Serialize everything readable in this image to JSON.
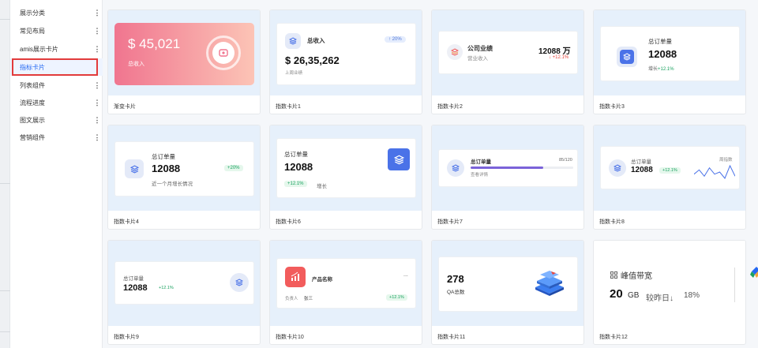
{
  "sidebar": {
    "items": [
      {
        "label": "展示分类"
      },
      {
        "label": "常见布局"
      },
      {
        "label": "amis展示卡片"
      },
      {
        "label": "指标卡片",
        "active": true
      },
      {
        "label": "列表组件"
      },
      {
        "label": "流程进度"
      },
      {
        "label": "图文展示"
      },
      {
        "label": "营销组件"
      }
    ],
    "more_glyph": "⋮"
  },
  "cards": [
    {
      "caption": "渐变卡片",
      "value": "$ 45,021",
      "label": "总收入"
    },
    {
      "caption": "指数卡片1",
      "title": "总收入",
      "badge": "↑ 20%",
      "value": "$ 26,35,262",
      "sub": "上周业绩"
    },
    {
      "caption": "指数卡片2",
      "title": "公司业绩",
      "sub": "营业收入",
      "value": "12088 万",
      "delta": "↓ +12.1%"
    },
    {
      "caption": "指数卡片3",
      "title": "总订单量",
      "value": "12088",
      "sub_prefix": "增长",
      "delta": "+12.1%"
    },
    {
      "caption": "指数卡片4",
      "title": "总订单量",
      "value": "12088",
      "badge": "+20%",
      "sub": "近一个月增长情况"
    },
    {
      "caption": "指数卡片6",
      "title": "总订单量",
      "value": "12088",
      "badge": "+12.1%",
      "sub": "增长"
    },
    {
      "caption": "指数卡片7",
      "title": "总订单量",
      "progress_text": "85/120",
      "progress": 0.708,
      "sub": "查看详情"
    },
    {
      "caption": "指数卡片8",
      "title": "总订单量",
      "value": "12088",
      "delta": "+12.1%",
      "right_label": "周指数",
      "sparkline": [
        3,
        5,
        2,
        6,
        3,
        4,
        1,
        7,
        2
      ]
    },
    {
      "caption": "指数卡片9",
      "title": "总订单量",
      "value": "12088",
      "delta": "+12.1%"
    },
    {
      "caption": "指数卡片10",
      "title": "产品名称",
      "more": "...",
      "owner_label": "负责人",
      "owner": "张三",
      "badge": "+12.1%"
    },
    {
      "caption": "指数卡片11",
      "value": "278",
      "sub": "QA总数"
    },
    {
      "caption": "指数卡片12",
      "title": "峰值带宽",
      "value": "20",
      "unit": "GB",
      "compare": "较昨日↓",
      "percent": "18%"
    }
  ],
  "colors": {
    "accent": "#2468f2",
    "active_outline": "#e23b3b",
    "gradient_start": "#f0758f",
    "gradient_end": "#fcc4b6",
    "icon_blue": "#4a72e8",
    "icon_light": "#e4eaf8",
    "progress": "#7b63d9",
    "red_icon": "#f25c5c"
  }
}
